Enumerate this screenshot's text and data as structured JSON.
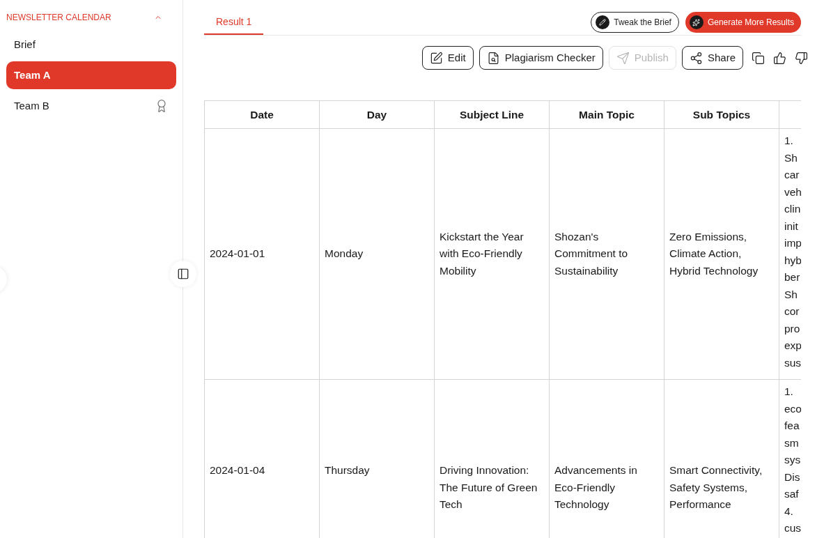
{
  "sidebar": {
    "section_title": "NEWSLETTER CALENDAR",
    "expanded": true,
    "items": [
      {
        "label": "Brief",
        "selected": false,
        "badge": false
      },
      {
        "label": "Team A",
        "selected": true,
        "badge": false
      },
      {
        "label": "Team B",
        "selected": false,
        "badge": true
      }
    ]
  },
  "tabs": [
    {
      "label": "Result 1",
      "selected": true
    }
  ],
  "top_buttons": [
    {
      "label": "Tweak the Brief",
      "kind": "outline"
    },
    {
      "label": "Generate More Results",
      "kind": "primary"
    }
  ],
  "toolbar": [
    {
      "label": "Edit",
      "kind": "edit",
      "disabled": false
    },
    {
      "label": "Plagiarism Checker",
      "kind": "plagiarism",
      "disabled": false
    },
    {
      "label": "Publish",
      "kind": "publish",
      "disabled": true
    },
    {
      "label": "Share",
      "kind": "share",
      "disabled": false
    }
  ],
  "table": {
    "columns": [
      "Date",
      "Day",
      "Subject Line",
      "Main Topic",
      "Sub Topics"
    ],
    "rows": [
      {
        "cells": [
          "2024-01-01",
          "Monday",
          "Kickstart the Year with Eco-Friendly Mobility",
          "Shozan's Commitment to Sustainability",
          "Zero Emissions, Climate Action, Hybrid Technology"
        ],
        "column_6_lines": [
          "1.",
          "Sh",
          "car",
          "veh",
          "clin",
          "init",
          "imp",
          "hyb",
          "ber",
          "Sh",
          "cor",
          "pro",
          "exp",
          "sus"
        ]
      },
      {
        "cells": [
          "2024-01-04",
          "Thursday",
          "Driving Innovation: The Future of Green Tech",
          "Advancements in Eco-Friendly Technology",
          "Smart Connectivity, Safety Systems, Performance"
        ],
        "column_6_lines": [
          "1.",
          "eco",
          "fea",
          "sm",
          "sys",
          "Dis",
          "saf",
          "4.",
          "cus"
        ]
      }
    ]
  }
}
